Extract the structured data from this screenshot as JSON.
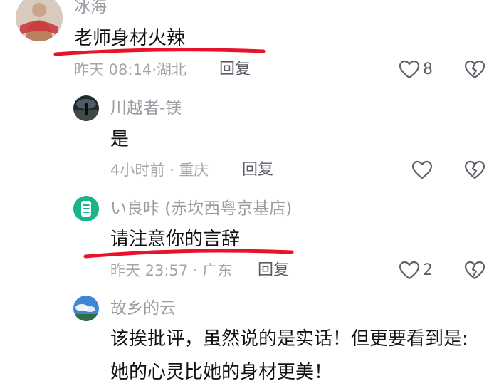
{
  "comments": [
    {
      "username": "冰海",
      "text": "老师身材火辣",
      "time": "昨天 08:14·",
      "location": "湖北",
      "reply_label": "回复",
      "likes": "8",
      "avatar_icon": "user-avatar-photo"
    },
    {
      "username": "川越者-镁",
      "text": "是",
      "time": "4小时前 · ",
      "location": "重庆",
      "reply_label": "回复",
      "likes": "",
      "avatar_icon": "user-avatar-photo"
    },
    {
      "username": "い良咔 (赤坎西粤京基店)",
      "text": "请注意你的言辞",
      "time": "昨天 23:57 · ",
      "location": "广东",
      "reply_label": "回复",
      "likes": "2",
      "avatar_icon": "shop-logo-avatar"
    },
    {
      "username": "故乡的云",
      "text_line1": "该挨批评，虽然说的是实话！但更要看到是:",
      "text_line2": "她的心灵比她的身材更美！",
      "avatar_icon": "user-avatar-photo"
    }
  ],
  "icons": {
    "like": "heart-outline-icon",
    "dislike": "broken-heart-icon"
  },
  "colors": {
    "annotation_underline": "#e8122b",
    "meta_text": "#a4a4ab",
    "username_text": "#9b9ba3"
  }
}
